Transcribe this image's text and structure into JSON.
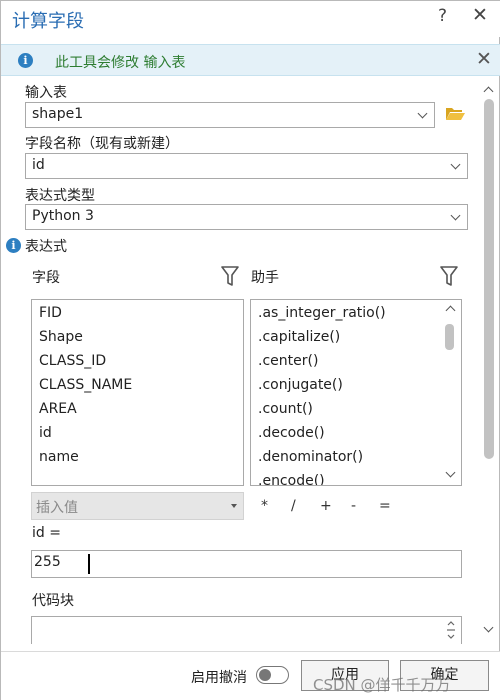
{
  "window": {
    "title": "计算字段",
    "help": "?",
    "close": "✕"
  },
  "info": {
    "message": "此工具会修改 输入表",
    "close": "✕"
  },
  "input_table": {
    "label": "输入表",
    "value": "shape1"
  },
  "field_name": {
    "label": "字段名称（现有或新建）",
    "value": "id"
  },
  "expression_type": {
    "label": "表达式类型",
    "value": "Python 3"
  },
  "expression": {
    "label": "表达式",
    "fields_header": "字段",
    "helpers_header": "助手",
    "fields": [
      "FID",
      "Shape",
      "CLASS_ID",
      "CLASS_NAME",
      "AREA",
      "id",
      "name"
    ],
    "helpers": [
      ".as_integer_ratio()",
      ".capitalize()",
      ".center()",
      ".conjugate()",
      ".count()",
      ".decode()",
      ".denominator()",
      ".encode()"
    ],
    "insert_value": "插入值",
    "operators": [
      "*",
      "/",
      "+",
      "-",
      "="
    ],
    "target_label": "id =",
    "value": "255"
  },
  "code_block": {
    "label": "代码块"
  },
  "footer": {
    "undo_label": "启用撤消",
    "apply": "应用",
    "ok": "确定"
  },
  "watermark": "CSDN @佯千千万万",
  "colors": {
    "title": "#2a6db3",
    "info_bg": "#e4f1f8",
    "info_text": "#2e7d32",
    "info_icon": "#2d7fc1"
  }
}
